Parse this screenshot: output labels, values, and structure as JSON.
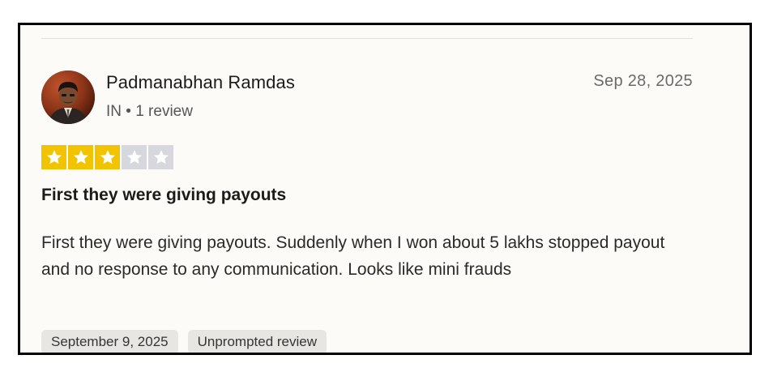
{
  "review": {
    "reviewer_name": "Padmanabhan Ramdas",
    "reviewer_meta": "IN • 1 review",
    "date": "Sep 28, 2025",
    "rating": 3,
    "max_rating": 5,
    "title": "First they were giving payouts",
    "body": "First they were giving payouts. Suddenly when I won about 5 lakhs stopped payout and no response to any communication. Looks like mini frauds",
    "experience_date": "September 9, 2025",
    "review_type": "Unprompted review"
  },
  "colors": {
    "star_filled": "#f2c400",
    "star_empty": "#d7d7de",
    "star_glyph": "#ffffff"
  },
  "icons": {
    "star": "star-icon",
    "avatar": "reviewer-photo"
  }
}
